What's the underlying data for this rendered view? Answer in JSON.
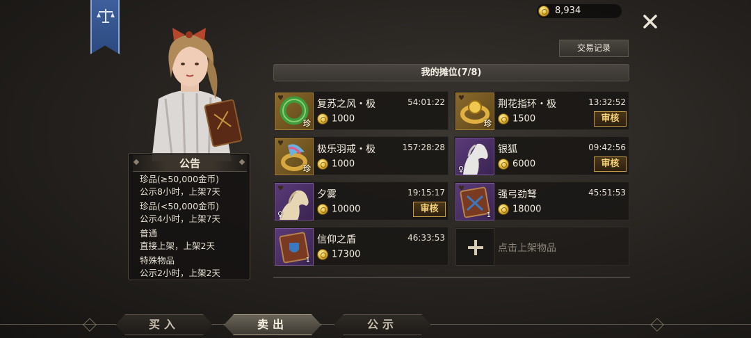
{
  "banner": {
    "icon": "balance-scale-icon"
  },
  "gold": {
    "amount": "8,934",
    "icon": "gold-coin-icon"
  },
  "close": {
    "icon": "close-icon"
  },
  "history_button": "交易记录",
  "stall_header": "我的摊位(7/8)",
  "notice": {
    "title": "公告",
    "blocks": [
      {
        "line1": "珍品(≥50,000金币)",
        "line2": "公示8小时，上架7天"
      },
      {
        "line1": "珍品(<50,000金币)",
        "line2": "公示4小时，上架7天"
      },
      {
        "line1": "普通",
        "line2": "直接上架，上架2天"
      },
      {
        "line1": "特殊物品",
        "line2": "公示2小时，上架2天"
      }
    ]
  },
  "slots": [
    {
      "name": "复苏之风・极",
      "time": "54:01:22",
      "price": "1000",
      "rare_tag": "珍",
      "icon": "green-ring-icon"
    },
    {
      "name": "荆花指环・极",
      "time": "13:32:52",
      "price": "1500",
      "rare_tag": "珍",
      "review": "审核",
      "icon": "gold-flower-ring-icon"
    },
    {
      "name": "极乐羽戒・极",
      "time": "157:28:28",
      "price": "1000",
      "rare_tag": "珍",
      "icon": "feather-ring-icon"
    },
    {
      "name": "银狐",
      "time": "09:42:56",
      "price": "6000",
      "review": "审核",
      "gender": "♀",
      "icon": "white-horse-icon"
    },
    {
      "name": "夕雾",
      "time": "19:15:17",
      "price": "10000",
      "review": "审核",
      "gender": "♀",
      "icon": "cream-horse-icon"
    },
    {
      "name": "强弓劲弩",
      "time": "45:51:53",
      "price": "18000",
      "count": "1",
      "icon": "bow-manual-icon"
    },
    {
      "name": "信仰之盾",
      "time": "46:33:53",
      "price": "17300",
      "count": "1",
      "icon": "shield-manual-icon"
    }
  ],
  "add_slot": {
    "label": "点击上架物品",
    "icon": "plus-icon"
  },
  "tabs": {
    "buy": "买入",
    "sell": "卖出",
    "public": "公示"
  },
  "colors": {
    "review_gold": "#f6d37a",
    "banner_blue": "#3e5f9c",
    "coin_gold": "#e0b430"
  }
}
